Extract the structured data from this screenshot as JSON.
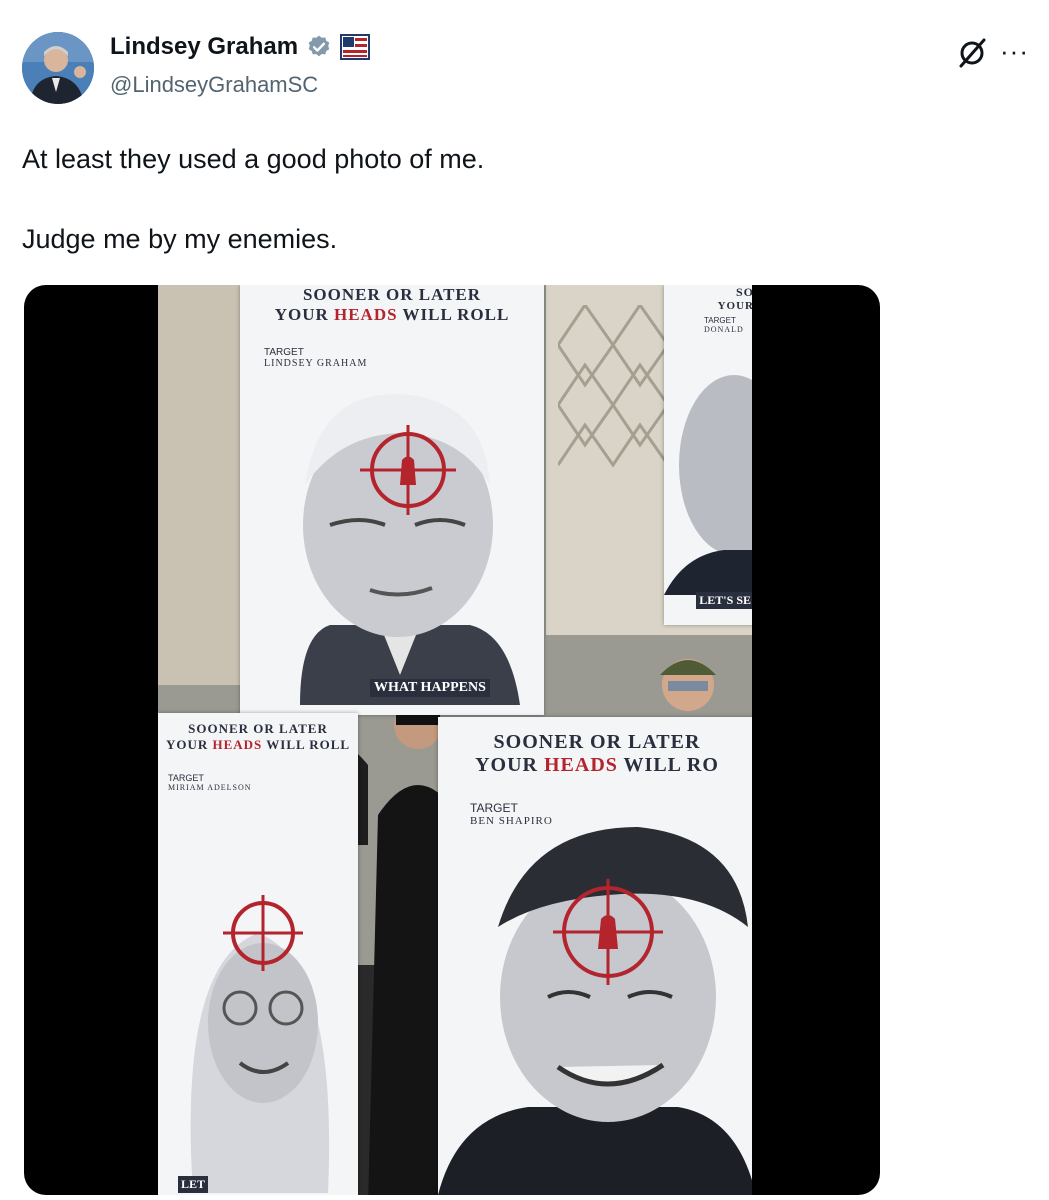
{
  "post": {
    "author_name": "Lindsey Graham",
    "handle": "@LindseyGrahamSC",
    "text_line1": "At least they used a good photo of me.",
    "text_line2": "Judge me by my enemies.",
    "more_label": "···"
  },
  "icons": {
    "verified": "verified-check-icon",
    "badge": "flag-affiliate-icon",
    "grok": "grok-icon",
    "more": "more-dots-icon"
  },
  "colors": {
    "verified": "#829aab",
    "text": "#0f1419",
    "handle": "#536471",
    "crosshair": "#b3242c"
  },
  "media": {
    "sign_top": {
      "line1": "SOONER OR LATER",
      "line2_a": "YOUR ",
      "line2_red": "HEADS",
      "line2_b": " WILL ROLL",
      "target_label": "TARGET",
      "target_name": "LINDSEY GRAHAM",
      "footer": "WHAT HAPPENS"
    },
    "sign_right_top": {
      "line1": "SO",
      "line2": "YOUR",
      "target_label": "TARGET",
      "target_name": "DONALD",
      "footer": "LET'S SE"
    },
    "sign_left": {
      "line1": "SOONER OR LATER",
      "line2_a": "YOUR ",
      "line2_red": "HEADS",
      "line2_b": " WILL ROLL",
      "target_label": "TARGET",
      "target_name": "MIRIAM ADELSON",
      "footer": "LET"
    },
    "sign_right": {
      "line1": "SOONER OR LATER",
      "line2_a": "YOUR ",
      "line2_red": "HEADS",
      "line2_b": " WILL RO",
      "target_label": "TARGET",
      "target_name": "BEN SHAPIRO"
    }
  }
}
